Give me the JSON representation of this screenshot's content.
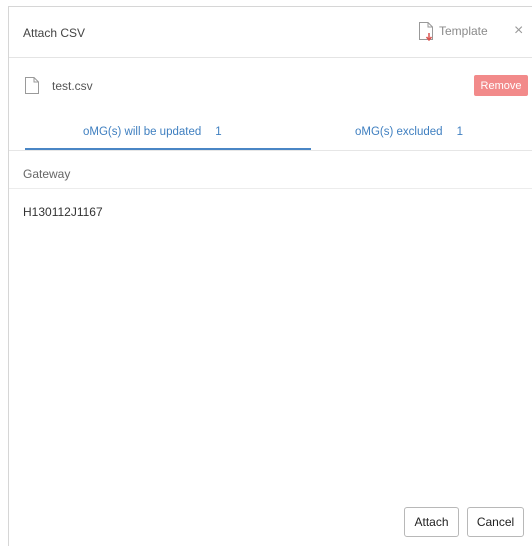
{
  "dialog": {
    "title": "Attach CSV",
    "template_label": "Template",
    "close_symbol": "×"
  },
  "file": {
    "name": "test.csv",
    "remove_label": "Remove"
  },
  "tabs": [
    {
      "label": "oMG(s) will be updated",
      "count": "1",
      "active": true
    },
    {
      "label": "oMG(s) excluded",
      "count": "1",
      "active": false
    }
  ],
  "table": {
    "columns": [
      "Gateway"
    ],
    "rows": [
      [
        "H130112J1167"
      ]
    ]
  },
  "footer": {
    "attach_label": "Attach",
    "cancel_label": "Cancel"
  },
  "icons": {
    "template": "template-download-icon",
    "file": "file-icon",
    "close": "close-icon"
  },
  "colors": {
    "accent": "#4a86c5",
    "tab_text": "#3f7fc0",
    "remove_button": "#f28a8a",
    "template_arrow": "#d9534f"
  }
}
